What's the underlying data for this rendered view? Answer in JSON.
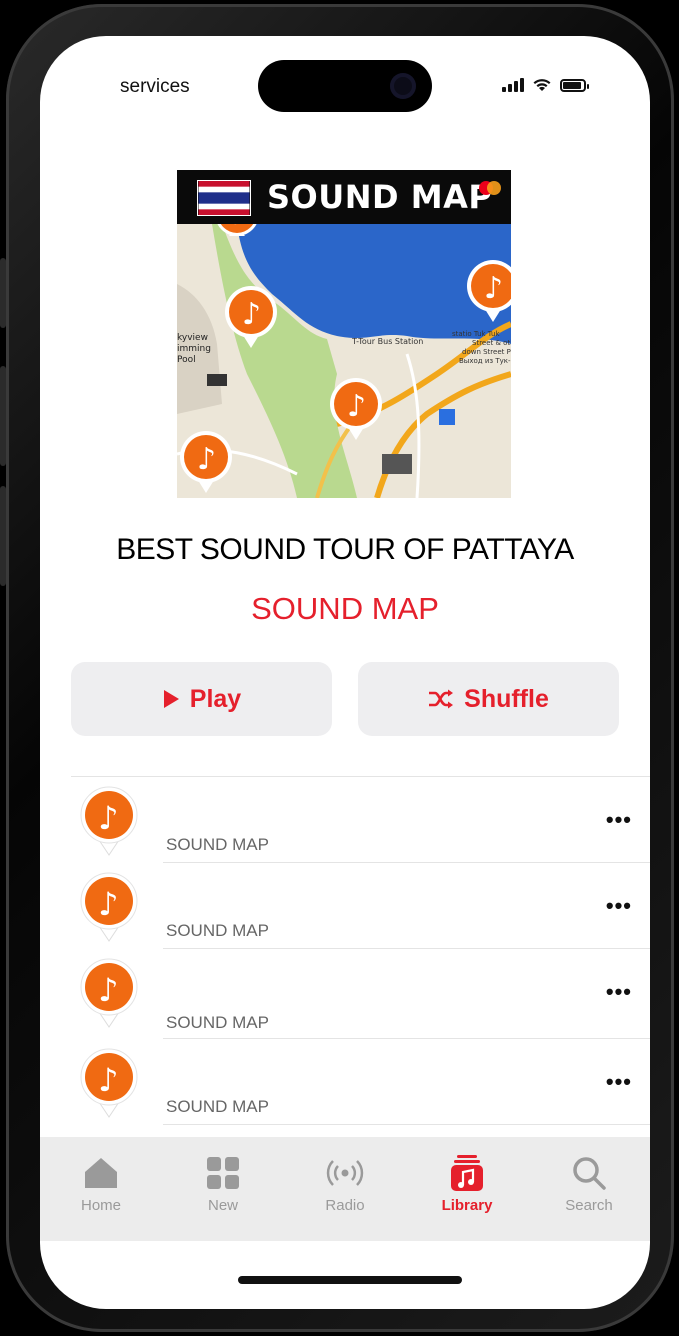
{
  "status_bar": {
    "carrier": "services"
  },
  "album": {
    "art_title": "SOUND MAP",
    "title": "BEST SOUND TOUR OF PATTAYA",
    "artist": "SOUND MAP",
    "map_labels": [
      "T-Tour Bus Station",
      "statio Tuk Tuk",
      "Street & oth",
      "down Street P",
      "Выход из Тук-",
      "kyview",
      "imming",
      "Pool"
    ]
  },
  "actions": {
    "play_label": "Play",
    "shuffle_label": "Shuffle"
  },
  "tracks": [
    {
      "artist": "SOUND MAP"
    },
    {
      "artist": "SOUND MAP"
    },
    {
      "artist": "SOUND MAP"
    },
    {
      "artist": "SOUND MAP"
    }
  ],
  "more_label": "•••",
  "tabs": [
    {
      "label": "Home",
      "icon": "house-icon"
    },
    {
      "label": "New",
      "icon": "grid-icon"
    },
    {
      "label": "Radio",
      "icon": "radio-waves-icon"
    },
    {
      "label": "Library",
      "icon": "music-note-library-icon",
      "active": true
    },
    {
      "label": "Search",
      "icon": "magnifier-icon"
    }
  ],
  "colors": {
    "accent": "#e5202c",
    "pin_orange": "#f06a12"
  }
}
